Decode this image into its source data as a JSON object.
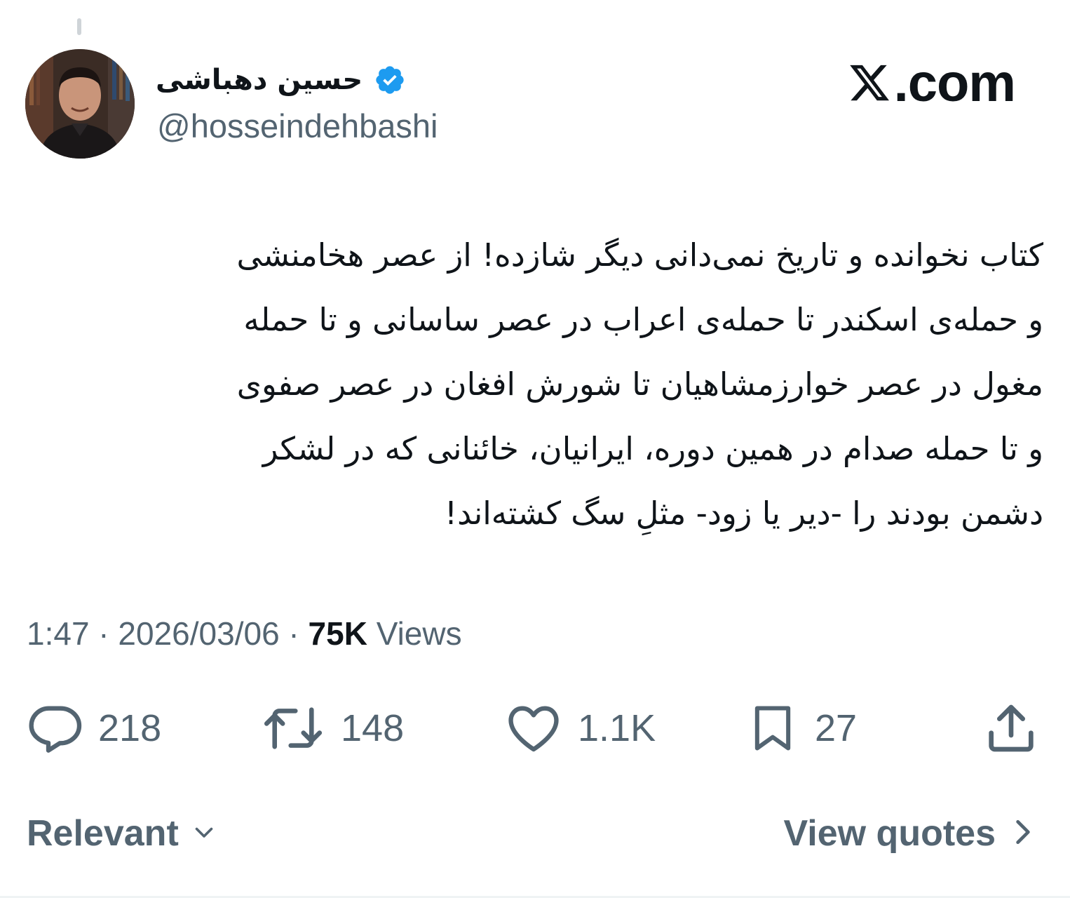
{
  "header": {
    "display_name": "حسین دهباشی",
    "handle": "@hosseindehbashi",
    "brand": ".com"
  },
  "tweet": {
    "lines": [
      "کتاب نخوانده و تاریخ نمی‌دانی دیگر شازده! از عصر هخامنشی",
      "و حمله‌ی اسکندر تا حمله‌ی اعراب در عصر ساسانی و تا حمله",
      "مغول در عصر خوارزمشاهیان تا شورش افغان در عصر صفوی",
      "و تا حمله صدام در همین دوره، ایرانیان، خائنانی که در لشکر",
      "دشمن بودند را -دیر یا زود- مثلِ سگ کشته‌اند!"
    ]
  },
  "meta": {
    "time": "1:47",
    "sep1": " · ",
    "date": "2026/03/06",
    "sep2": " · ",
    "views_count": "75K",
    "views_label": " Views"
  },
  "actions": {
    "replies": "218",
    "reposts": "148",
    "likes": "1.1K",
    "bookmarks": "27"
  },
  "footer": {
    "sort_label": "Relevant",
    "quotes_label": "View quotes"
  },
  "colors": {
    "verified": "#1d9bf0",
    "text": "#0f1419",
    "secondary": "#536471"
  },
  "icons": {
    "verified": "verified-badge-icon",
    "brand": "x-logo-icon",
    "reply": "reply-icon",
    "repost": "repost-icon",
    "like": "heart-icon",
    "bookmark": "bookmark-icon",
    "share": "share-icon",
    "sort": "chevron-down-icon",
    "quotes": "chevron-right-icon"
  }
}
